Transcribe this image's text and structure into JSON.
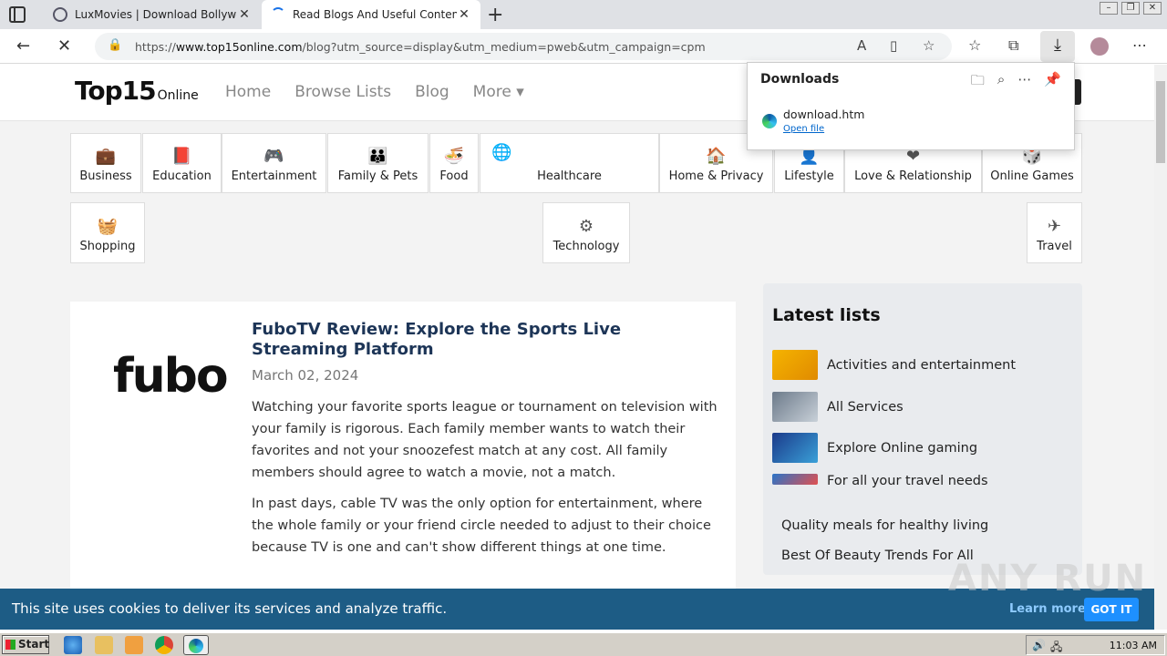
{
  "browser": {
    "tabs": [
      {
        "title": "LuxMovies | Download Bollywood",
        "active": false
      },
      {
        "title": "Read Blogs And Useful Content |",
        "active": true
      }
    ],
    "url_prefix": "https://",
    "url_host": "www.top15online.com",
    "url_path": "/blog?utm_source=display&utm_medium=pweb&utm_campaign=cpm"
  },
  "site": {
    "logo_main": "Top15",
    "logo_sub": "Online",
    "menu": [
      "Home",
      "Browse Lists",
      "Blog",
      "More ▾"
    ]
  },
  "categories": [
    {
      "label": "Business"
    },
    {
      "label": "Education"
    },
    {
      "label": "Entertainment"
    },
    {
      "label": "Family & Pets"
    },
    {
      "label": "Food"
    },
    {
      "label": "Healthcare"
    },
    {
      "label": "Home & Privacy"
    },
    {
      "label": "Lifestyle"
    },
    {
      "label": "Love & Relationship"
    },
    {
      "label": "Online Games"
    },
    {
      "label": "Shopping"
    },
    {
      "label": "Technology"
    },
    {
      "label": "Travel"
    }
  ],
  "article": {
    "logo_text": "fubo",
    "title": "FuboTV Review: Explore the Sports Live Streaming Platform",
    "date": "March 02, 2024",
    "para1": "Watching your favorite sports league or tournament on television with your family is rigorous. Each family member wants to watch their favorites and not your snoozefest match at any cost. All family members should agree to watch a movie, not a match.",
    "para2": "In past days, cable TV was the only option for entertainment, where the whole family or your friend circle needed to adjust to their choice because TV is one and can't show different things at one time."
  },
  "sidebar": {
    "title": "Latest lists",
    "items": [
      "Activities and entertainment",
      "All Services",
      "Explore Online gaming",
      "For all your travel needs",
      "Quality meals for healthy living",
      "Best Of Beauty Trends For All"
    ]
  },
  "downloads": {
    "title": "Downloads",
    "file_name": "download.htm",
    "open_link": "Open file"
  },
  "cookie": {
    "text": "This site uses cookies to deliver its services and analyze traffic.",
    "learn_more": "Learn more",
    "got_it": "GOT IT"
  },
  "watermark": "ANY RUN",
  "taskbar": {
    "start": "Start",
    "clock": "11:03 AM"
  }
}
